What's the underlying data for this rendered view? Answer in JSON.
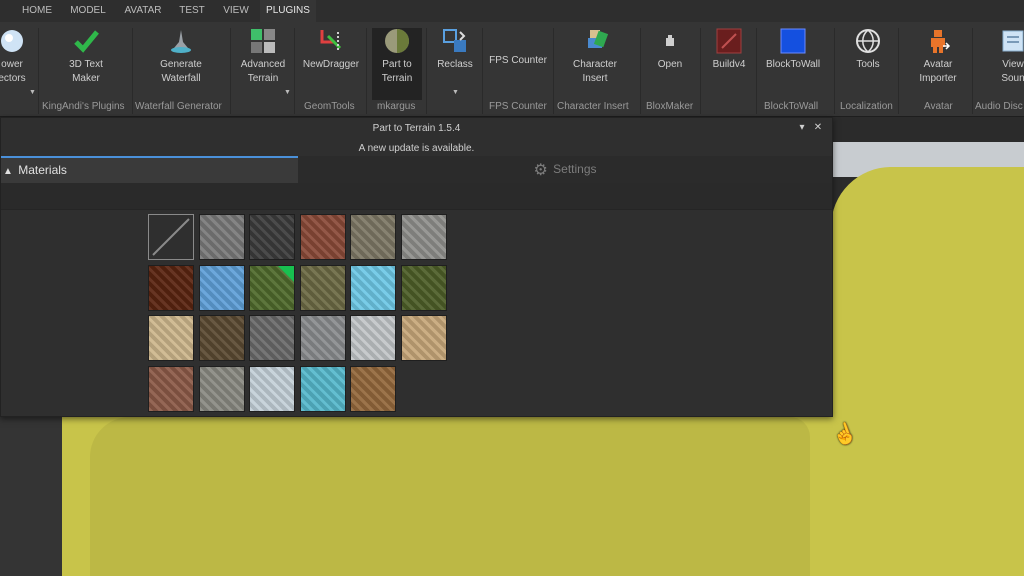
{
  "menu": {
    "tabs": [
      {
        "label": "HOME"
      },
      {
        "label": "MODEL"
      },
      {
        "label": "AVATAR"
      },
      {
        "label": "TEST"
      },
      {
        "label": "VIEW"
      },
      {
        "label": "PLUGINS"
      }
    ],
    "active": "PLUGINS"
  },
  "ribbon": {
    "buttons": [
      {
        "line1": "ower",
        "line2": "ectors"
      },
      {
        "line1": "3D Text",
        "line2": "Maker"
      },
      {
        "line1": "Generate",
        "line2": "Waterfall"
      },
      {
        "line1": "Advanced",
        "line2": "Terrain"
      },
      {
        "line1": "NewDragger",
        "line2": ""
      },
      {
        "line1": "Part to",
        "line2": "Terrain"
      },
      {
        "line1": "Reclass",
        "line2": ""
      },
      {
        "line1": "FPS Counter",
        "line2": ""
      },
      {
        "line1": "Character",
        "line2": "Insert"
      },
      {
        "line1": "Open",
        "line2": ""
      },
      {
        "line1": "Buildv4",
        "line2": ""
      },
      {
        "line1": "BlockToWall",
        "line2": ""
      },
      {
        "line1": "Tools",
        "line2": ""
      },
      {
        "line1": "Avatar",
        "line2": "Importer"
      },
      {
        "line1": "View",
        "line2": "Soun"
      }
    ],
    "groups": [
      {
        "label": "KingAndi's Plugins"
      },
      {
        "label": "Waterfall Generator"
      },
      {
        "label": "GeomTools"
      },
      {
        "label": "mkargus"
      },
      {
        "label": "FPS Counter"
      },
      {
        "label": "Character Insert"
      },
      {
        "label": "BloxMaker"
      },
      {
        "label": "BlockToWall"
      },
      {
        "label": "Localization"
      },
      {
        "label": "Avatar"
      },
      {
        "label": "Audio Disc"
      }
    ]
  },
  "panel": {
    "title": "Part to Terrain 1.5.4",
    "update_notice": "A new update is available.",
    "tab_materials": "Materials",
    "tab_settings": "Settings",
    "materials": [
      {
        "name": "none",
        "color": "#2f2f2f"
      },
      {
        "name": "slate",
        "color": "#7a7a7a"
      },
      {
        "name": "basalt",
        "color": "#3c3c3c"
      },
      {
        "name": "brick",
        "color": "#8a4a38"
      },
      {
        "name": "cobblestone",
        "color": "#7d7765"
      },
      {
        "name": "concrete",
        "color": "#8f8f8c"
      },
      {
        "name": "cracked-lava",
        "color": "#5a2410"
      },
      {
        "name": "glacier",
        "color": "#5fa0d8"
      },
      {
        "name": "grass",
        "color": "#4f6a2c"
      },
      {
        "name": "ground",
        "color": "#6c6a44"
      },
      {
        "name": "ice",
        "color": "#6ec8e6"
      },
      {
        "name": "leafy-grass",
        "color": "#4d5e28"
      },
      {
        "name": "limestone",
        "color": "#cdb68c"
      },
      {
        "name": "mud",
        "color": "#5b4a32"
      },
      {
        "name": "pavement",
        "color": "#6a6a6a"
      },
      {
        "name": "rock",
        "color": "#8a8c8e"
      },
      {
        "name": "salt",
        "color": "#c2c6c8"
      },
      {
        "name": "sand",
        "color": "#c7a77a"
      },
      {
        "name": "sandstone",
        "color": "#8c5a48"
      },
      {
        "name": "slate-gray",
        "color": "#8a8a82"
      },
      {
        "name": "snow",
        "color": "#c4d0d8"
      },
      {
        "name": "water",
        "color": "#56b8cc"
      },
      {
        "name": "wood-planks",
        "color": "#94683c"
      }
    ]
  },
  "colors": {
    "accent": "#4a90d9",
    "terrain": "#c8c44a"
  }
}
